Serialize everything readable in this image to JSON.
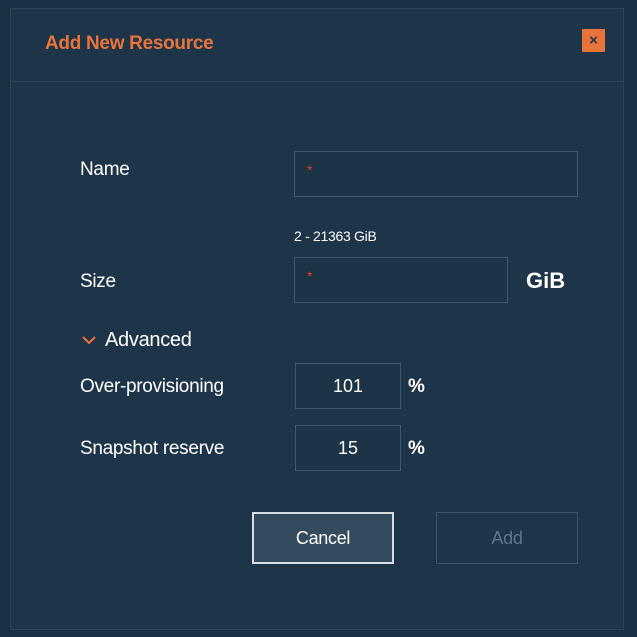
{
  "dialog": {
    "title": "Add New Resource",
    "close_label": "×"
  },
  "form": {
    "name": {
      "label": "Name",
      "value": "",
      "required_marker": "*"
    },
    "size": {
      "label": "Size",
      "hint": "2 - 21363 GiB",
      "value": "",
      "required_marker": "*",
      "unit": "GiB"
    },
    "advanced": {
      "label": "Advanced",
      "expanded": true,
      "over_provisioning": {
        "label": "Over-provisioning",
        "value": "101",
        "unit": "%"
      },
      "snapshot_reserve": {
        "label": "Snapshot reserve",
        "value": "15",
        "unit": "%"
      }
    }
  },
  "buttons": {
    "cancel_label": "Cancel",
    "add_label": "Add"
  },
  "colors": {
    "accent": "#e8743c",
    "background": "#1e3448",
    "required": "#e33a2a"
  },
  "icons": {
    "close": "close-icon",
    "advanced_toggle": "chevron-down-icon"
  }
}
